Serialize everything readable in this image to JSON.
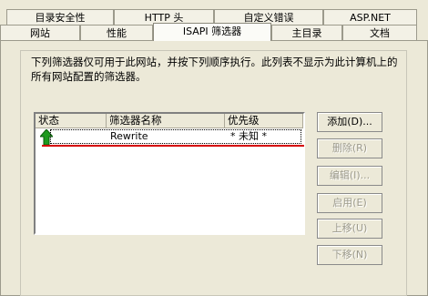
{
  "tabs_back": [
    "目录安全性",
    "HTTP 头",
    "自定义错误",
    "ASP.NET"
  ],
  "tabs_front": [
    "网站",
    "性能",
    "ISAPI 筛选器",
    "主目录",
    "文档"
  ],
  "description": "下列筛选器仅可用于此网站，并按下列顺序执行。此列表不显示为此计算机上的所有网站配置的筛选器。",
  "list": {
    "headers": [
      "状态",
      "筛选器名称",
      "优先级"
    ],
    "rows": [
      {
        "status_icon": "green-up-arrow-icon",
        "name": "Rewrite",
        "priority": "* 未知 *"
      }
    ]
  },
  "buttons": {
    "add": "添加(D)...",
    "remove": "删除(R)",
    "edit": "编辑(I)...",
    "enable": "启用(E)",
    "move_up": "上移(U)",
    "move_down": "下移(N)"
  },
  "colors": {
    "annotation_line": "#d40000",
    "status_icon": "#1e9a1e"
  }
}
